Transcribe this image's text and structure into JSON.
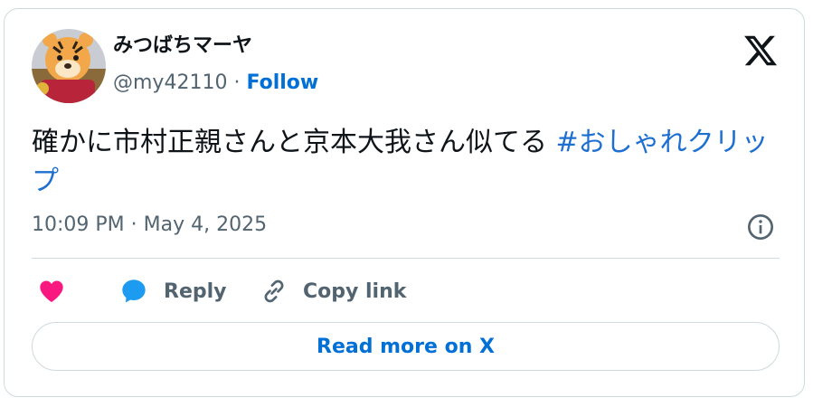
{
  "author": {
    "display_name": "みつばちマーヤ",
    "handle": "@my42110",
    "separator": "·",
    "follow_label": "Follow"
  },
  "tweet": {
    "text": "確かに市村正親さんと京本大我さん似てる ",
    "hashtag": "#おしゃれクリップ",
    "timestamp": "10:09 PM · May 4, 2025"
  },
  "actions": {
    "like_icon": "heart-icon",
    "reply_label": "Reply",
    "reply_icon": "speech-bubble-icon",
    "copy_link_label": "Copy link",
    "copy_link_icon": "link-icon"
  },
  "footer": {
    "read_more_label": "Read more on X"
  },
  "icons": {
    "brand": "x-logo-icon",
    "info": "info-icon"
  },
  "colors": {
    "accent": "#006fd6",
    "hashtag": "#1d6fd1",
    "like": "#f91880",
    "reply": "#1d9bf0",
    "text": "#0f1419",
    "muted": "#536471",
    "border": "#cfd9de"
  }
}
